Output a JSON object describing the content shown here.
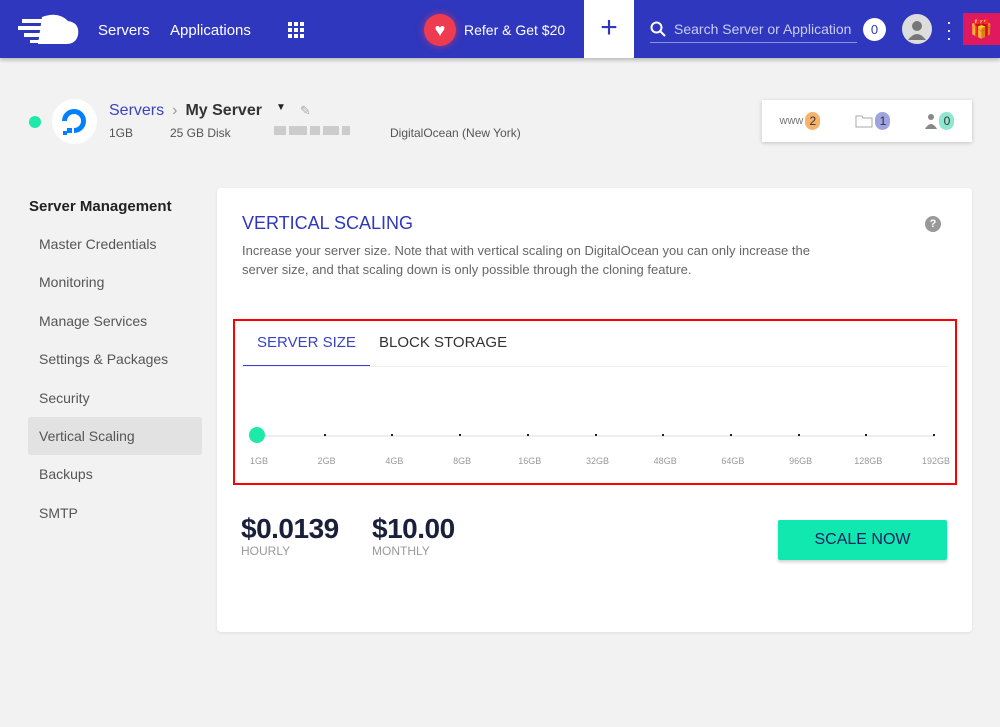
{
  "topbar": {
    "nav": [
      "Servers",
      "Applications"
    ],
    "refer_label": "Refer & Get $20",
    "search_placeholder": "Search Server or Application",
    "notifications": "0",
    "colors": {
      "bar": "#2f37be",
      "refer": "#ef3b4f",
      "gift": "#e0195f"
    }
  },
  "server": {
    "breadcrumb_root": "Servers",
    "name": "My Server",
    "ram": "1GB",
    "disk": "25 GB Disk",
    "provider": "DigitalOcean (New York)",
    "status_color": "#1de9a8"
  },
  "counts": [
    {
      "icon": "www-icon",
      "label": "www",
      "value": "2",
      "color": "#f6b26b"
    },
    {
      "icon": "folder-icon",
      "label": "",
      "value": "1",
      "color": "#9fa3e0"
    },
    {
      "icon": "user-icon",
      "label": "",
      "value": "0",
      "color": "#8ee8d0"
    }
  ],
  "sidebar": {
    "title": "Server Management",
    "items": [
      "Master Credentials",
      "Monitoring",
      "Manage Services",
      "Settings & Packages",
      "Security",
      "Vertical Scaling",
      "Backups",
      "SMTP"
    ],
    "active": "Vertical Scaling"
  },
  "panel": {
    "title": "VERTICAL SCALING",
    "description": "Increase your server size. Note that with vertical scaling on DigitalOcean you can only increase the server size, and that scaling down is only possible through the cloning feature.",
    "tabs": [
      "SERVER SIZE",
      "BLOCK STORAGE"
    ],
    "active_tab": "SERVER SIZE",
    "slider": {
      "stops": [
        "1GB",
        "2GB",
        "4GB",
        "8GB",
        "16GB",
        "32GB",
        "48GB",
        "64GB",
        "96GB",
        "128GB",
        "192GB"
      ],
      "selected_index": 0
    },
    "hourly_price": "$0.0139",
    "hourly_label": "HOURLY",
    "monthly_price": "$10.00",
    "monthly_label": "MONTHLY",
    "scale_button": "SCALE NOW"
  }
}
